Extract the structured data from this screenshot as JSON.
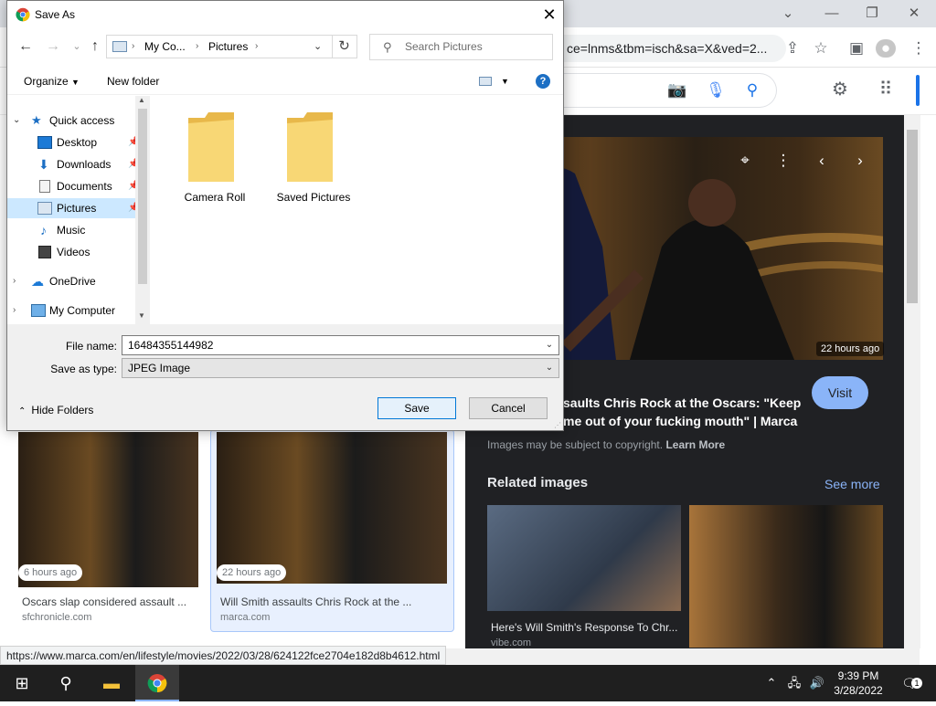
{
  "browser": {
    "url_fragment": "ce=lnms&tbm=isch&sa=X&ved=2...",
    "status_url": "https://www.marca.com/en/lifestyle/movies/2022/03/28/624122fce2704e182d8b4612.html"
  },
  "panel": {
    "time_badge": "22 hours ago",
    "visit_label": "Visit",
    "title_line1": "saults Chris Rock at the Oscars: \"Keep",
    "title_line2": "me out of your fucking mouth\" | Marca",
    "copyright": "Images may be subject to copyright.",
    "learn_more": "Learn More",
    "related_heading": "Related images",
    "see_more": "See more",
    "related": [
      {
        "caption": "Here's Will Smith's Response To Chr...",
        "source": "vibe.com"
      },
      {
        "caption": "",
        "source": ""
      }
    ]
  },
  "results": [
    {
      "time": "6 hours ago",
      "title": "Oscars slap considered assault ...",
      "source": "sfchronicle.com"
    },
    {
      "time": "22 hours ago",
      "title": "Will Smith assaults Chris Rock at the ...",
      "source": "marca.com"
    }
  ],
  "dialog": {
    "title": "Save As",
    "breadcrumb": [
      "My Co...",
      "Pictures"
    ],
    "search_placeholder": "Search Pictures",
    "organize_label": "Organize",
    "new_folder_label": "New folder",
    "nav": [
      {
        "label": "Quick access",
        "icon": "star-icon"
      },
      {
        "label": "Desktop",
        "icon": "desktop-icon",
        "pinned": true
      },
      {
        "label": "Downloads",
        "icon": "download-icon",
        "pinned": true
      },
      {
        "label": "Documents",
        "icon": "document-icon",
        "pinned": true
      },
      {
        "label": "Pictures",
        "icon": "pictures-icon",
        "pinned": true,
        "selected": true
      },
      {
        "label": "Music",
        "icon": "music-icon"
      },
      {
        "label": "Videos",
        "icon": "video-icon"
      },
      {
        "label": "OneDrive",
        "icon": "cloud-icon"
      },
      {
        "label": "My Computer",
        "icon": "computer-icon"
      }
    ],
    "folders": [
      {
        "name": "Camera Roll"
      },
      {
        "name": "Saved Pictures"
      }
    ],
    "file_name_label": "File name:",
    "file_name_value": "16484355144982",
    "save_type_label": "Save as type:",
    "save_type_value": "JPEG Image",
    "hide_folders_label": "Hide Folders",
    "save_label": "Save",
    "cancel_label": "Cancel"
  },
  "taskbar": {
    "time": "9:39 PM",
    "date": "3/28/2022",
    "notification_count": "1"
  },
  "colors": {
    "accent": "#0078d7",
    "panel_bg": "#202124",
    "link_blue": "#8ab4f8",
    "taskbar": "#1f1f1f"
  }
}
